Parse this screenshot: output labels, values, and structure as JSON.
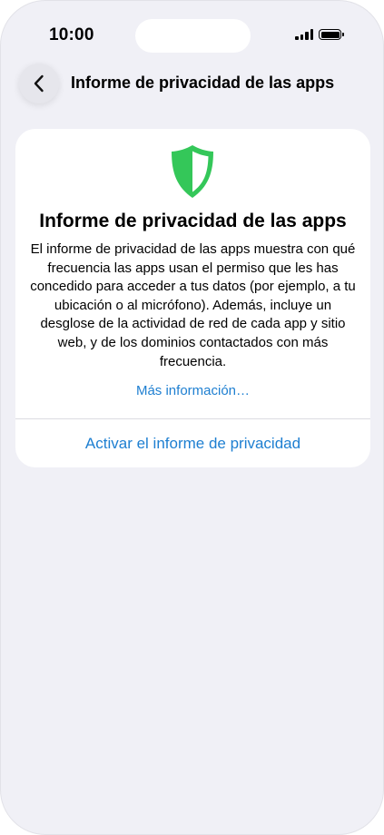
{
  "status_bar": {
    "time": "10:00"
  },
  "nav": {
    "back_icon": "chevron-left-icon",
    "title": "Informe de privacidad de las apps"
  },
  "card": {
    "icon": "shield-icon",
    "icon_color": "#34c759",
    "title": "Informe de privacidad de las apps",
    "description": "El informe de privacidad de las apps muestra con qué frecuencia las apps usan el permiso que les has concedido para acceder a tus datos (por ejemplo, a tu ubicación o al micrófono). Además, incluye un desglose de la actividad de red de cada app y sitio web, y de los dominios contactados con más frecuencia.",
    "more_link": "Más información…",
    "action_button": "Activar el informe de privacidad"
  },
  "colors": {
    "background": "#f0f0f6",
    "card": "#ffffff",
    "link": "#1e7fd1",
    "shield_green": "#34c759"
  }
}
